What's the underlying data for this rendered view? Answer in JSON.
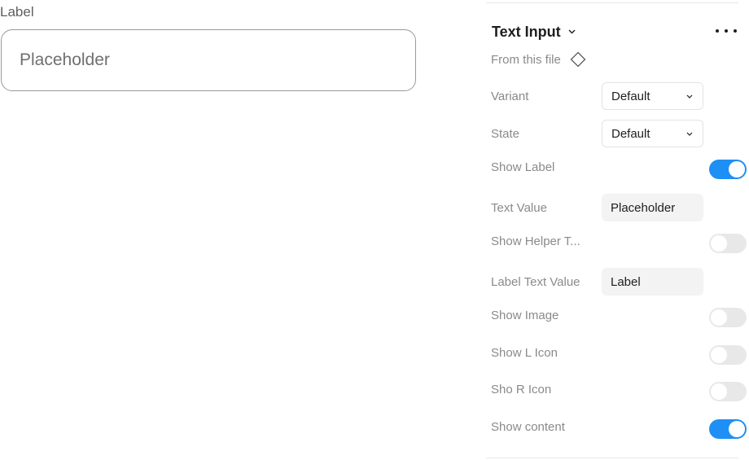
{
  "preview": {
    "label": "Label",
    "placeholder": "Placeholder"
  },
  "panel": {
    "component_name": "Text Input",
    "source_text": "From this file",
    "more_icon": "more-horizontal-icon",
    "source_icon": "component-diamond-icon",
    "accent_color": "#1e8ff5",
    "properties": {
      "variant": {
        "label": "Variant",
        "value": "Default"
      },
      "state": {
        "label": "State",
        "value": "Default"
      },
      "show_label": {
        "label": "Show Label",
        "value": true
      },
      "text_value": {
        "label": "Text Value",
        "value": "Placeholder"
      },
      "show_helper_text": {
        "label": "Show Helper T...",
        "value": false
      },
      "label_text_value": {
        "label": "Label Text Value",
        "value": "Label"
      },
      "show_image": {
        "label": "Show Image",
        "value": false
      },
      "show_l_icon": {
        "label": "Show L Icon",
        "value": false
      },
      "sho_r_icon": {
        "label": "Sho R Icon",
        "value": false
      },
      "show_content": {
        "label": "Show content",
        "value": true
      }
    }
  }
}
